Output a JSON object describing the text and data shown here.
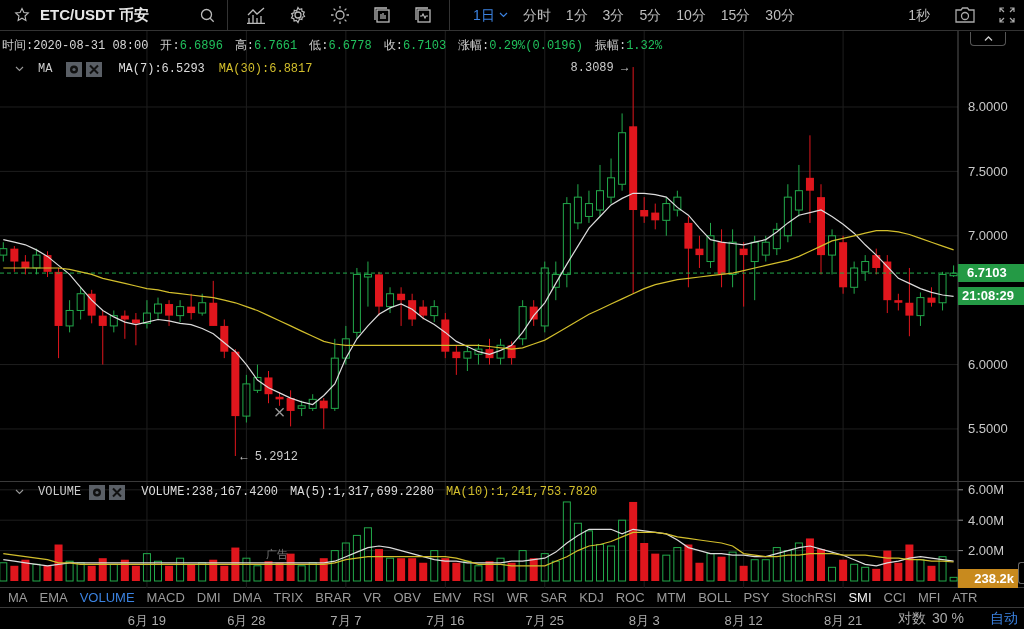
{
  "header": {
    "symbol": "ETC/USDT 币安"
  },
  "timeframes": [
    {
      "label": "1日",
      "selected": true
    },
    {
      "label": "分时",
      "selected": false
    },
    {
      "label": "1分",
      "selected": false
    },
    {
      "label": "3分",
      "selected": false
    },
    {
      "label": "5分",
      "selected": false
    },
    {
      "label": "10分",
      "selected": false
    },
    {
      "label": "15分",
      "selected": false
    },
    {
      "label": "30分",
      "selected": false
    }
  ],
  "realtime": "1秒",
  "ohlc_info": [
    {
      "label": "时间:",
      "value": "2020-08-31 08:00",
      "color": "#d9d9d9"
    },
    {
      "label": "开:",
      "value": "6.6896",
      "color": "#20c05c"
    },
    {
      "label": "高:",
      "value": "6.7661",
      "color": "#20c05c"
    },
    {
      "label": "低:",
      "value": "6.6778",
      "color": "#20c05c"
    },
    {
      "label": "收:",
      "value": "6.7103",
      "color": "#20c05c"
    },
    {
      "label": "涨幅:",
      "value": "0.29%(0.0196)",
      "color": "#20c05c"
    },
    {
      "label": "振幅:",
      "value": "1.32%",
      "color": "#20c05c"
    }
  ],
  "price_pane": {
    "indicator": "MA",
    "legend": [
      {
        "value": ":6.5293",
        "color": "#dcdcdc"
      },
      {
        "value": ":6.8817",
        "color": "#d2be2c"
      }
    ],
    "countdown": "21:08:29",
    "chart_data": {
      "type": "candlestick",
      "grid": true,
      "ylim": [
        5.096,
        8.59
      ],
      "ohlc": [
        [
          6.85,
          6.95,
          6.8,
          6.9
        ],
        [
          6.9,
          6.92,
          6.72,
          6.8
        ],
        [
          6.8,
          6.85,
          6.7,
          6.75
        ],
        [
          6.75,
          6.9,
          6.7,
          6.85
        ],
        [
          6.85,
          6.88,
          6.68,
          6.72
        ],
        [
          6.72,
          6.75,
          6.05,
          6.3
        ],
        [
          6.3,
          6.5,
          6.25,
          6.42
        ],
        [
          6.42,
          6.6,
          6.35,
          6.55
        ],
        [
          6.55,
          6.58,
          6.32,
          6.38
        ],
        [
          6.38,
          6.42,
          6.0,
          6.3
        ],
        [
          6.3,
          6.42,
          6.25,
          6.38
        ],
        [
          6.38,
          6.42,
          6.2,
          6.35
        ],
        [
          6.35,
          6.4,
          6.15,
          6.32
        ],
        [
          6.32,
          6.5,
          6.28,
          6.4
        ],
        [
          6.4,
          6.52,
          6.35,
          6.47
        ],
        [
          6.47,
          6.5,
          6.3,
          6.38
        ],
        [
          6.38,
          6.5,
          6.33,
          6.45
        ],
        [
          6.45,
          6.55,
          6.35,
          6.4
        ],
        [
          6.4,
          6.55,
          6.38,
          6.48
        ],
        [
          6.48,
          6.65,
          6.3,
          6.3
        ],
        [
          6.3,
          6.35,
          6.05,
          6.1
        ],
        [
          6.1,
          6.12,
          5.29,
          5.6
        ],
        [
          5.6,
          5.92,
          5.55,
          5.85
        ],
        [
          5.8,
          6.0,
          5.78,
          5.9
        ],
        [
          5.9,
          5.95,
          5.7,
          5.77
        ],
        [
          5.75,
          5.78,
          5.68,
          5.73
        ],
        [
          5.74,
          5.8,
          5.52,
          5.64
        ],
        [
          5.66,
          5.72,
          5.6,
          5.68
        ],
        [
          5.66,
          5.77,
          5.64,
          5.73
        ],
        [
          5.72,
          5.74,
          5.5,
          5.66
        ],
        [
          5.66,
          6.2,
          5.64,
          6.05
        ],
        [
          6.05,
          6.3,
          6.0,
          6.2
        ],
        [
          6.25,
          6.75,
          6.2,
          6.7
        ],
        [
          6.68,
          6.8,
          6.45,
          6.7
        ],
        [
          6.7,
          6.72,
          6.38,
          6.45
        ],
        [
          6.45,
          6.6,
          6.4,
          6.55
        ],
        [
          6.55,
          6.6,
          6.3,
          6.5
        ],
        [
          6.5,
          6.55,
          6.3,
          6.35
        ],
        [
          6.45,
          6.5,
          6.35,
          6.38
        ],
        [
          6.38,
          6.5,
          6.33,
          6.45
        ],
        [
          6.35,
          6.4,
          6.05,
          6.1
        ],
        [
          6.1,
          6.15,
          5.92,
          6.05
        ],
        [
          6.05,
          6.15,
          5.95,
          6.1
        ],
        [
          6.08,
          6.16,
          6.0,
          6.12
        ],
        [
          6.12,
          6.2,
          6.0,
          6.05
        ],
        [
          6.05,
          6.2,
          6.0,
          6.15
        ],
        [
          6.15,
          6.18,
          6.0,
          6.05
        ],
        [
          6.2,
          6.5,
          6.15,
          6.45
        ],
        [
          6.45,
          6.5,
          6.3,
          6.35
        ],
        [
          6.3,
          6.8,
          6.25,
          6.75
        ],
        [
          6.6,
          6.8,
          6.5,
          6.7
        ],
        [
          6.7,
          7.3,
          6.6,
          7.25
        ],
        [
          7.1,
          7.4,
          7.05,
          7.3
        ],
        [
          7.15,
          7.35,
          7.1,
          7.25
        ],
        [
          7.2,
          7.55,
          7.15,
          7.35
        ],
        [
          7.3,
          7.6,
          7.25,
          7.45
        ],
        [
          7.4,
          7.95,
          7.35,
          7.8
        ],
        [
          7.85,
          8.31,
          6.55,
          7.2
        ],
        [
          7.2,
          7.3,
          7.1,
          7.15
        ],
        [
          7.18,
          7.25,
          7.05,
          7.12
        ],
        [
          7.12,
          7.3,
          7.0,
          7.25
        ],
        [
          7.2,
          7.35,
          7.15,
          7.3
        ],
        [
          7.1,
          7.15,
          6.6,
          6.9
        ],
        [
          6.9,
          7.0,
          6.75,
          6.85
        ],
        [
          6.8,
          7.1,
          6.75,
          7.0
        ],
        [
          6.95,
          7.05,
          6.6,
          6.7
        ],
        [
          6.7,
          7.05,
          6.6,
          6.95
        ],
        [
          6.9,
          6.95,
          6.45,
          6.85
        ],
        [
          6.8,
          7.0,
          6.5,
          6.95
        ],
        [
          6.85,
          7.0,
          6.8,
          6.95
        ],
        [
          6.9,
          7.1,
          6.85,
          7.05
        ],
        [
          7.0,
          7.4,
          6.95,
          7.3
        ],
        [
          7.2,
          7.55,
          7.15,
          7.35
        ],
        [
          7.45,
          7.78,
          7.1,
          7.35
        ],
        [
          7.3,
          7.4,
          6.7,
          6.85
        ],
        [
          6.85,
          7.05,
          6.7,
          7.0
        ],
        [
          6.95,
          7.0,
          6.55,
          6.6
        ],
        [
          6.6,
          6.8,
          6.55,
          6.75
        ],
        [
          6.72,
          6.85,
          6.65,
          6.8
        ],
        [
          6.85,
          6.9,
          6.7,
          6.75
        ],
        [
          6.8,
          6.85,
          6.4,
          6.5
        ],
        [
          6.5,
          6.55,
          6.42,
          6.48
        ],
        [
          6.48,
          6.75,
          6.22,
          6.38
        ],
        [
          6.38,
          6.56,
          6.3,
          6.52
        ],
        [
          6.52,
          6.6,
          6.45,
          6.48
        ],
        [
          6.48,
          6.72,
          6.42,
          6.7
        ],
        [
          6.69,
          6.77,
          6.68,
          6.71
        ]
      ],
      "yticks": [
        {
          "value": 8,
          "label": "8.0000"
        },
        {
          "value": 7.5,
          "label": "7.5000"
        },
        {
          "value": 7,
          "label": "7.0000"
        },
        {
          "value": 6,
          "label": "6.0000"
        },
        {
          "value": 5.5,
          "label": "5.5000"
        }
      ],
      "series": [
        {
          "name": "MA(7)",
          "type": "line",
          "color": "#dcdcdc",
          "values": [
            6.97,
            6.95,
            6.93,
            6.89,
            6.84,
            6.77,
            6.7,
            6.6,
            6.5,
            6.42,
            6.37,
            6.33,
            6.31,
            6.33,
            6.35,
            6.34,
            6.32,
            6.31,
            6.28,
            6.24,
            6.17,
            6.1,
            6.0,
            5.88,
            5.82,
            5.78,
            5.74,
            5.71,
            5.69,
            5.76,
            5.85,
            6.05,
            6.2,
            6.3,
            6.39,
            6.44,
            6.47,
            6.43,
            6.36,
            6.31,
            6.25,
            6.18,
            6.14,
            6.1,
            6.08,
            6.11,
            6.15,
            6.25,
            6.38,
            6.48,
            6.63,
            6.78,
            6.92,
            7.06,
            7.15,
            7.24,
            7.29,
            7.33,
            7.33,
            7.32,
            7.3,
            7.22,
            7.16,
            7.06,
            6.97,
            6.95,
            6.94,
            6.93,
            6.95,
            6.97,
            7.03,
            7.1,
            7.16,
            7.18,
            7.2,
            7.15,
            7.09,
            7.02,
            6.93,
            6.85,
            6.76,
            6.67,
            6.63,
            6.59,
            6.56,
            6.54,
            6.53
          ]
        },
        {
          "name": "MA(30)",
          "type": "line",
          "color": "#d2be2c",
          "values": [
            6.75,
            6.75,
            6.75,
            6.75,
            6.75,
            6.75,
            6.74,
            6.72,
            6.7,
            6.67,
            6.65,
            6.63,
            6.61,
            6.59,
            6.58,
            6.56,
            6.55,
            6.54,
            6.53,
            6.52,
            6.5,
            6.48,
            6.45,
            6.42,
            6.38,
            6.34,
            6.3,
            6.26,
            6.22,
            6.18,
            6.16,
            6.15,
            6.15,
            6.15,
            6.15,
            6.15,
            6.15,
            6.15,
            6.15,
            6.15,
            6.15,
            6.15,
            6.15,
            6.15,
            6.14,
            6.13,
            6.12,
            6.13,
            6.16,
            6.19,
            6.24,
            6.29,
            6.34,
            6.39,
            6.43,
            6.47,
            6.51,
            6.55,
            6.59,
            6.62,
            6.64,
            6.66,
            6.67,
            6.68,
            6.69,
            6.7,
            6.71,
            6.73,
            6.75,
            6.77,
            6.79,
            6.81,
            6.84,
            6.88,
            6.92,
            6.96,
            6.98,
            7.0,
            7.02,
            7.04,
            7.04,
            7.03,
            7.01,
            6.98,
            6.95,
            6.92,
            6.89
          ]
        }
      ],
      "ref_lines": [
        {
          "axis": "y",
          "value": 6.7103,
          "label": "6.7103"
        }
      ],
      "annotations": [
        "8.3089 →",
        "← 5.2912"
      ]
    }
  },
  "volume_pane": {
    "indicator": "VOLUME",
    "legend": [
      {
        "value": "VOLUME:238,167.4200",
        "color": "#dcdcdc"
      },
      {
        "value": ":1,317,699.2280",
        "color": "#dcdcdc"
      },
      {
        "value": ":1,241,753.7820",
        "color": "#d2be2c"
      }
    ],
    "ad_label": "广告",
    "last_volume": "238.2k",
    "chart_data": {
      "type": "bar",
      "grid": true,
      "ylim": [
        0,
        6.513
      ],
      "categories": [
        null,
        null,
        null,
        null,
        null,
        null,
        null,
        null,
        null,
        null,
        null,
        null,
        null,
        "6月 19",
        null,
        null,
        null,
        null,
        null,
        null,
        null,
        null,
        "6月 28",
        null,
        null,
        null,
        null,
        null,
        null,
        null,
        null,
        "7月 7",
        null,
        null,
        null,
        null,
        null,
        null,
        null,
        null,
        "7月 16",
        null,
        null,
        null,
        null,
        null,
        null,
        null,
        null,
        "7月 25",
        null,
        null,
        null,
        null,
        null,
        null,
        null,
        null,
        "8月 3",
        null,
        null,
        null,
        null,
        null,
        null,
        null,
        null,
        "8月 12",
        null,
        null,
        null,
        null,
        null,
        null,
        null,
        null,
        "8月 21",
        null,
        null,
        null,
        null,
        null,
        null,
        null,
        null,
        null,
        null
      ],
      "yticks": [
        {
          "value": 6,
          "label": "6.00M"
        },
        {
          "value": 4,
          "label": "4.00M"
        },
        {
          "value": 2,
          "label": "2.00M"
        }
      ],
      "series": [
        {
          "colors": [
            "#22a94a",
            "#e0161d",
            "#e0161d",
            "#22a94a",
            "#e0161d",
            "#e0161d",
            "#22a94a",
            "#22a94a",
            "#e0161d",
            "#e0161d",
            "#22a94a",
            "#e0161d",
            "#e0161d",
            "#22a94a",
            "#22a94a",
            "#e0161d",
            "#22a94a",
            "#e0161d",
            "#22a94a",
            "#e0161d",
            "#e0161d",
            "#e0161d",
            "#22a94a",
            "#22a94a",
            "#e0161d",
            "#e0161d",
            "#e0161d",
            "#22a94a",
            "#22a94a",
            "#e0161d",
            "#22a94a",
            "#22a94a",
            "#22a94a",
            "#22a94a",
            "#e0161d",
            "#22a94a",
            "#e0161d",
            "#e0161d",
            "#e0161d",
            "#22a94a",
            "#e0161d",
            "#e0161d",
            "#22a94a",
            "#22a94a",
            "#e0161d",
            "#22a94a",
            "#e0161d",
            "#22a94a",
            "#e0161d",
            "#22a94a",
            "#22a94a",
            "#22a94a",
            "#22a94a",
            "#22a94a",
            "#22a94a",
            "#22a94a",
            "#22a94a",
            "#e0161d",
            "#e0161d",
            "#e0161d",
            "#22a94a",
            "#22a94a",
            "#e0161d",
            "#e0161d",
            "#22a94a",
            "#e0161d",
            "#22a94a",
            "#e0161d",
            "#22a94a",
            "#22a94a",
            "#22a94a",
            "#22a94a",
            "#22a94a",
            "#e0161d",
            "#e0161d",
            "#22a94a",
            "#e0161d",
            "#22a94a",
            "#22a94a",
            "#e0161d",
            "#e0161d",
            "#e0161d",
            "#e0161d",
            "#22a94a",
            "#e0161d",
            "#22a94a",
            "#22a94a"
          ],
          "values": [
            1.2,
            1.0,
            1.4,
            1.1,
            1.0,
            2.4,
            1.3,
            1.2,
            1.0,
            1.5,
            1.1,
            1.4,
            1.0,
            1.8,
            1.3,
            1.0,
            1.5,
            1.1,
            1.2,
            1.4,
            1.0,
            2.2,
            1.5,
            1.0,
            1.3,
            1.2,
            1.8,
            1.0,
            1.2,
            1.5,
            2.0,
            2.5,
            3.0,
            3.5,
            2.1,
            1.5,
            1.5,
            1.5,
            1.2,
            2.0,
            1.5,
            1.2,
            1.3,
            1.0,
            1.3,
            1.5,
            1.2,
            2.0,
            1.5,
            1.8,
            1.3,
            5.2,
            3.8,
            3.3,
            2.4,
            2.3,
            4.0,
            5.2,
            2.5,
            1.8,
            1.7,
            2.2,
            2.4,
            1.2,
            1.8,
            1.6,
            1.9,
            1.0,
            1.4,
            1.4,
            2.2,
            2.0,
            2.5,
            2.8,
            2.1,
            0.9,
            1.4,
            1.1,
            0.9,
            0.8,
            2.0,
            1.2,
            2.4,
            1.4,
            1.0,
            1.6,
            0.24
          ]
        },
        {
          "name": "MA(5)",
          "type": "line",
          "color": "#dcdcdc",
          "values": [
            1.4,
            1.3,
            1.2,
            1.1,
            1.0,
            1.1,
            1.2,
            1.2,
            1.2,
            1.2,
            1.2,
            1.2,
            1.2,
            1.2,
            1.2,
            1.2,
            1.2,
            1.2,
            1.2,
            1.2,
            1.2,
            1.2,
            1.2,
            1.2,
            1.2,
            1.2,
            1.2,
            1.2,
            1.2,
            1.2,
            1.3,
            1.6,
            1.9,
            2.2,
            2.3,
            2.2,
            2.0,
            1.8,
            1.6,
            1.4,
            1.3,
            1.3,
            1.2,
            1.2,
            1.2,
            1.2,
            1.3,
            1.3,
            1.4,
            1.5,
            1.9,
            2.5,
            3.0,
            3.4,
            3.4,
            3.4,
            3.1,
            3.4,
            3.3,
            3.2,
            3.1,
            2.7,
            2.2,
            2.0,
            1.8,
            1.8,
            1.7,
            1.7,
            1.6,
            1.6,
            1.8,
            2.0,
            2.2,
            2.3,
            2.1,
            1.9,
            1.7,
            1.4,
            1.1,
            1.0,
            1.2,
            1.3,
            1.5,
            1.6,
            1.5,
            1.4,
            1.3
          ]
        },
        {
          "name": "MA(10)",
          "type": "line",
          "color": "#d2be2c",
          "values": [
            1.8,
            1.7,
            1.6,
            1.5,
            1.4,
            1.2,
            1.2,
            1.1,
            1.1,
            1.1,
            1.1,
            1.1,
            1.1,
            1.1,
            1.1,
            1.1,
            1.1,
            1.1,
            1.1,
            1.1,
            1.1,
            1.1,
            1.1,
            1.1,
            1.1,
            1.1,
            1.1,
            1.1,
            1.1,
            1.1,
            1.2,
            1.4,
            1.5,
            1.6,
            1.6,
            1.6,
            1.6,
            1.6,
            1.6,
            1.6,
            1.6,
            1.5,
            1.3,
            1.1,
            1.1,
            1.1,
            1.0,
            1.0,
            1.0,
            1.0,
            1.3,
            1.6,
            2.0,
            2.3,
            2.4,
            2.6,
            2.9,
            3.2,
            3.2,
            3.2,
            3.1,
            2.9,
            2.8,
            2.7,
            2.6,
            2.5,
            2.3,
            1.8,
            1.7,
            1.6,
            1.6,
            1.7,
            1.7,
            1.8,
            1.8,
            1.8,
            1.7,
            1.7,
            1.7,
            1.6,
            1.5,
            1.5,
            1.4,
            1.4,
            1.3,
            1.3,
            1.25
          ]
        }
      ]
    }
  },
  "indicators": [
    {
      "label": "MA",
      "selected": false,
      "highlighted": false
    },
    {
      "label": "EMA",
      "selected": false,
      "highlighted": false
    },
    {
      "label": "VOLUME",
      "selected": true,
      "highlighted": false
    },
    {
      "label": "MACD",
      "selected": false,
      "highlighted": false
    },
    {
      "label": "DMI",
      "selected": false,
      "highlighted": false
    },
    {
      "label": "DMA",
      "selected": false,
      "highlighted": false
    },
    {
      "label": "TRIX",
      "selected": false,
      "highlighted": false
    },
    {
      "label": "BRAR",
      "selected": false,
      "highlighted": false
    },
    {
      "label": "VR",
      "selected": false,
      "highlighted": false
    },
    {
      "label": "OBV",
      "selected": false,
      "highlighted": false
    },
    {
      "label": "EMV",
      "selected": false,
      "highlighted": false
    },
    {
      "label": "RSI",
      "selected": false,
      "highlighted": false
    },
    {
      "label": "WR",
      "selected": false,
      "highlighted": false
    },
    {
      "label": "SAR",
      "selected": false,
      "highlighted": false
    },
    {
      "label": "KDJ",
      "selected": false,
      "highlighted": false
    },
    {
      "label": "ROC",
      "selected": false,
      "highlighted": false
    },
    {
      "label": "MTM",
      "selected": false,
      "highlighted": false
    },
    {
      "label": "BOLL",
      "selected": false,
      "highlighted": false
    },
    {
      "label": "PSY",
      "selected": false,
      "highlighted": false
    },
    {
      "label": "StochRSI",
      "selected": false,
      "highlighted": false
    },
    {
      "label": "SMI",
      "selected": false,
      "highlighted": true
    },
    {
      "label": "CCI",
      "selected": false,
      "highlighted": false
    },
    {
      "label": "MFI",
      "selected": false,
      "highlighted": false
    },
    {
      "label": "ATR",
      "selected": false,
      "highlighted": false
    }
  ],
  "scale_options": [
    {
      "label": "对数",
      "selected": false
    },
    {
      "label": "30 %",
      "selected": false
    },
    {
      "label": "自动",
      "selected": true
    }
  ]
}
